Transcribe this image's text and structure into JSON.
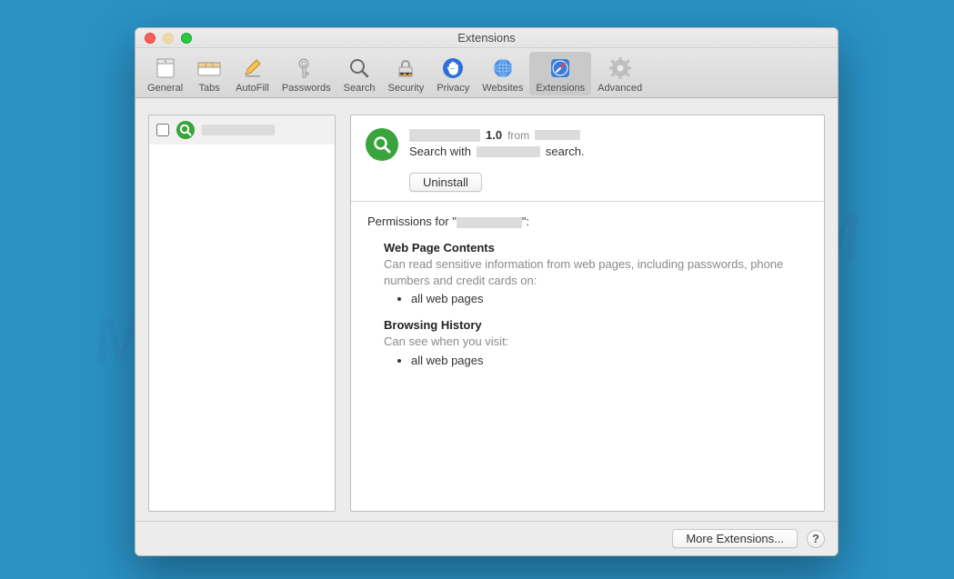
{
  "watermark": "MYANTISPYWARE.COM",
  "window": {
    "title": "Extensions"
  },
  "toolbar": {
    "items": [
      {
        "label": "General"
      },
      {
        "label": "Tabs"
      },
      {
        "label": "AutoFill"
      },
      {
        "label": "Passwords"
      },
      {
        "label": "Search"
      },
      {
        "label": "Security"
      },
      {
        "label": "Privacy"
      },
      {
        "label": "Websites"
      },
      {
        "label": "Extensions"
      },
      {
        "label": "Advanced"
      }
    ]
  },
  "sidebar": {
    "items": [
      {
        "checked": false
      }
    ]
  },
  "detail": {
    "version": "1.0",
    "from_label": "from",
    "desc_prefix": "Search with",
    "desc_suffix": "search.",
    "uninstall_label": "Uninstall"
  },
  "permissions": {
    "title_prefix": "Permissions for \"",
    "title_suffix": "\":",
    "sections": [
      {
        "head": "Web Page Contents",
        "desc": "Can read sensitive information from web pages, including passwords, phone numbers and credit cards on:",
        "items": [
          "all web pages"
        ]
      },
      {
        "head": "Browsing History",
        "desc": "Can see when you visit:",
        "items": [
          "all web pages"
        ]
      }
    ]
  },
  "footer": {
    "more_label": "More Extensions...",
    "help_label": "?"
  }
}
